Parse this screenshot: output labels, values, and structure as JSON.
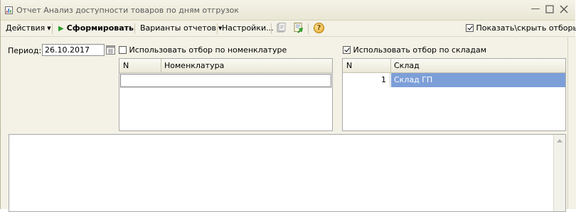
{
  "window": {
    "title": "Отчет  Анализ доступности товаров по дням отгрузок"
  },
  "toolbar": {
    "actions_label": "Действия",
    "generate_label": "Сформировать",
    "variants_label": "Варианты отчетов",
    "settings_label": "Настройки...",
    "help_glyph": "?",
    "show_filters_label": "Показать\\скрыть отборы",
    "show_filters_checked": true
  },
  "period": {
    "label": "Период:",
    "value": "26.10.2017"
  },
  "nomenclature_filter": {
    "checkbox_label": "Использовать отбор по номенклатуре",
    "checked": false,
    "columns": [
      "N",
      "Номенклатура"
    ],
    "rows": []
  },
  "warehouse_filter": {
    "checkbox_label": "Использовать отбор по складам",
    "checked": true,
    "columns": [
      "N",
      "Склад"
    ],
    "rows": [
      {
        "n": "1",
        "name": "Склад ГП"
      }
    ]
  },
  "colors": {
    "selection": "#7d9fd8",
    "accent_green": "#2c9b28"
  }
}
